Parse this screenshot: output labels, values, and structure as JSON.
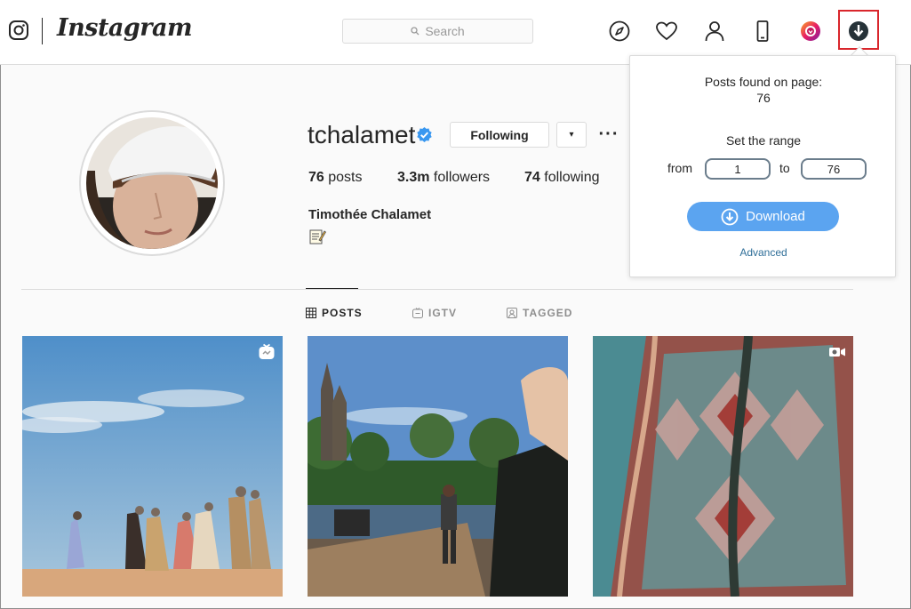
{
  "nav": {
    "wordmark": "Instagram",
    "search_placeholder": "Search",
    "icons": [
      "instagram-glyph-icon",
      "compass-icon",
      "heart-icon",
      "profile-icon",
      "mobile-icon",
      "extension-gradient-icon",
      "download-extension-icon"
    ]
  },
  "profile": {
    "username": "tchalamet",
    "following_label": "Following",
    "dropdown_glyph": "▾",
    "more_glyph": "···",
    "stats": [
      {
        "num": "76",
        "label": " posts"
      },
      {
        "num": "3.3m",
        "label": " followers"
      },
      {
        "num": "74",
        "label": " following"
      }
    ],
    "full_name": "Timothée Chalamet"
  },
  "tabs": [
    {
      "label": "POSTS",
      "icon": "grid-icon",
      "active": true
    },
    {
      "label": "IGTV",
      "icon": "igtv-icon",
      "active": false
    },
    {
      "label": "TAGGED",
      "icon": "tagged-icon",
      "active": false
    }
  ],
  "posts": [
    {
      "badge": "igtv-icon"
    },
    {
      "badge": ""
    },
    {
      "badge": "video-icon"
    }
  ],
  "popup": {
    "found_label": "Posts found on page:",
    "found_count": "76",
    "range_title": "Set the range",
    "from_label": "from",
    "from_value": "1",
    "to_label": "to",
    "to_value": "76",
    "download_label": "Download",
    "advanced_label": "Advanced"
  },
  "colors": {
    "accent_blue": "#5ba4f0",
    "highlight_red": "#d9262c",
    "link": "#2e6e98"
  }
}
